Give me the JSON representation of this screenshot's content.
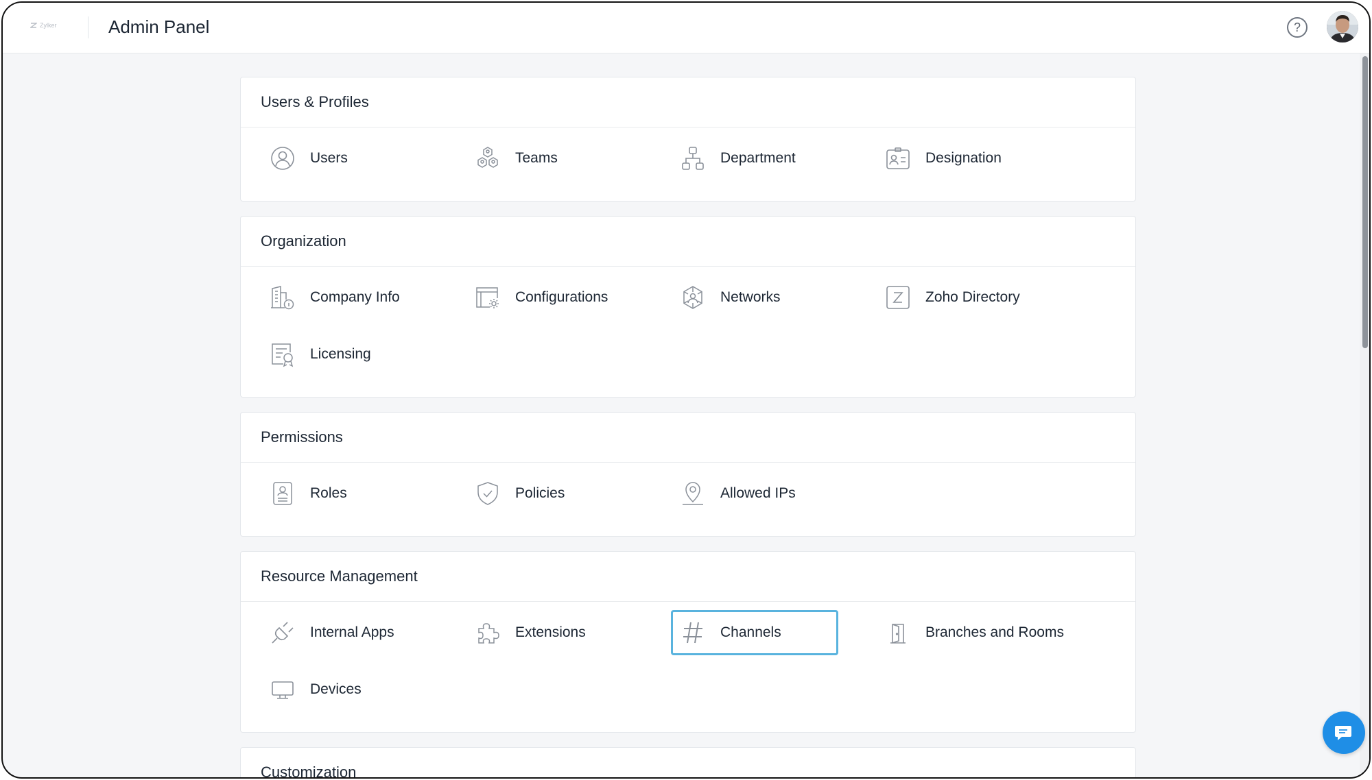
{
  "header": {
    "logo_text": "Zylker",
    "title": "Admin Panel",
    "help_glyph": "?"
  },
  "sections": [
    {
      "title": "Users & Profiles",
      "items": [
        {
          "label": "Users",
          "icon": "user-icon"
        },
        {
          "label": "Teams",
          "icon": "teams-icon"
        },
        {
          "label": "Department",
          "icon": "department-icon"
        },
        {
          "label": "Designation",
          "icon": "designation-icon"
        }
      ]
    },
    {
      "title": "Organization",
      "items": [
        {
          "label": "Company Info",
          "icon": "company-info-icon"
        },
        {
          "label": "Configurations",
          "icon": "configurations-icon"
        },
        {
          "label": "Networks",
          "icon": "networks-icon"
        },
        {
          "label": "Zoho Directory",
          "icon": "zoho-directory-icon"
        },
        {
          "label": "Licensing",
          "icon": "licensing-icon"
        }
      ]
    },
    {
      "title": "Permissions",
      "items": [
        {
          "label": "Roles",
          "icon": "roles-icon"
        },
        {
          "label": "Policies",
          "icon": "shield-icon"
        },
        {
          "label": "Allowed IPs",
          "icon": "location-pin-icon"
        }
      ]
    },
    {
      "title": "Resource Management",
      "items": [
        {
          "label": "Internal Apps",
          "icon": "plug-icon"
        },
        {
          "label": "Extensions",
          "icon": "puzzle-icon"
        },
        {
          "label": "Channels",
          "icon": "hash-icon",
          "selected": true
        },
        {
          "label": "Branches and Rooms",
          "icon": "door-icon"
        },
        {
          "label": "Devices",
          "icon": "monitor-icon"
        }
      ]
    },
    {
      "title": "Customization",
      "items": []
    }
  ],
  "colors": {
    "accent_selected": "#59b3de",
    "chat_button": "#1f8ee6",
    "icon_stroke": "#8a9099"
  }
}
